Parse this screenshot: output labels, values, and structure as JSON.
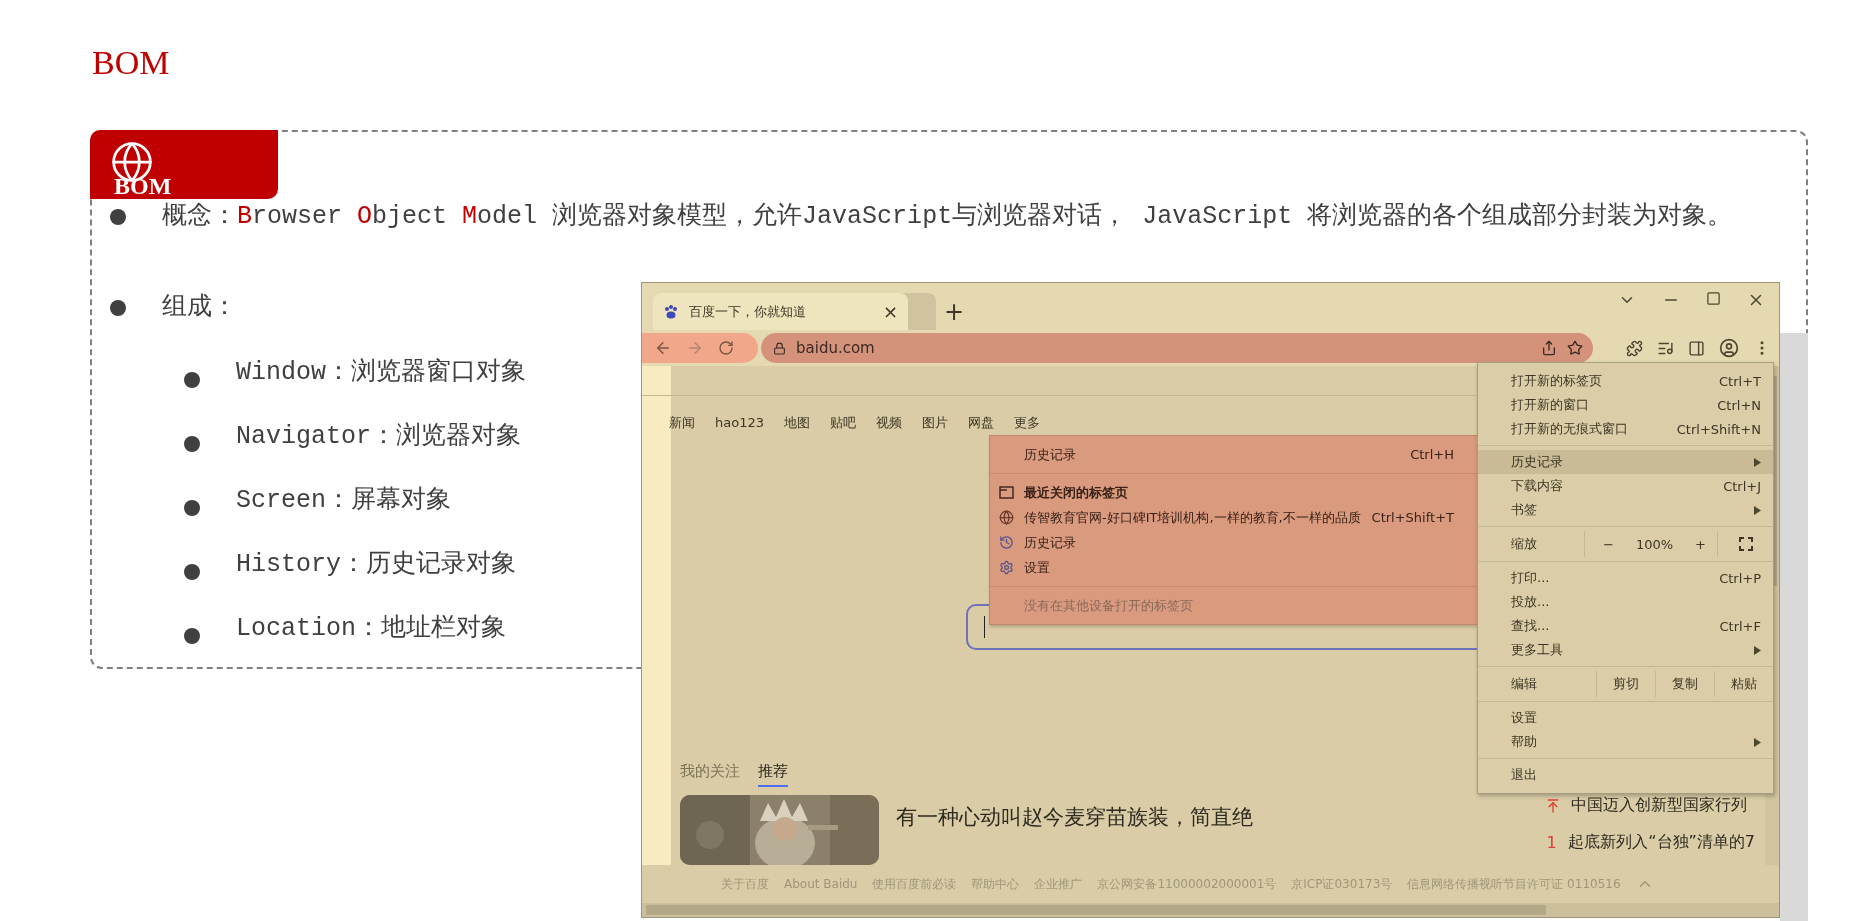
{
  "slide": {
    "title": "BOM",
    "badge_label": "BOM"
  },
  "bullets": [
    {
      "segments": [
        {
          "text": "概念：",
          "accent": false
        },
        {
          "text": "B",
          "accent": true
        },
        {
          "text": "rowser ",
          "accent": false
        },
        {
          "text": "O",
          "accent": true
        },
        {
          "text": "bject ",
          "accent": false
        },
        {
          "text": "M",
          "accent": true
        },
        {
          "text": "odel  浏览器对象模型，允许JavaScript与浏览器对话， JavaScript 将浏览器的各个组成部分封装为对象。",
          "accent": false
        }
      ]
    },
    {
      "segments": [
        {
          "text": "组成：",
          "accent": false
        }
      ],
      "children": [
        "Window：浏览器窗口对象",
        "Navigator：浏览器对象",
        "Screen：屏幕对象",
        "History：历史记录对象",
        "Location：地址栏对象"
      ]
    }
  ],
  "browser": {
    "tab": {
      "title": "百度一下，你就知道",
      "close": "×"
    },
    "new_tab": "+",
    "address": "baidu.com",
    "nav_links": [
      "新闻",
      "hao123",
      "地图",
      "贴吧",
      "视频",
      "图片",
      "网盘",
      "更多"
    ],
    "feed_tabs": [
      {
        "label": "我的关注",
        "selected": false
      },
      {
        "label": "推荐",
        "selected": true
      }
    ],
    "news": {
      "kind": "picture",
      "headline": "有一种心动叫赵今麦穿苗族装，简直绝"
    },
    "hot_list": [
      {
        "kind": "top",
        "text": "中国迈入创新型国家行列"
      },
      {
        "kind": "rank",
        "rank": "1",
        "text": "起底新列入“台独”清单的7"
      }
    ],
    "footer_links": [
      "关于百度",
      "About Baidu",
      "使用百度前必读",
      "帮助中心",
      "企业推广",
      "京公网安备11000002000001号",
      "京ICP证030173号",
      "信息网络传播视听节目许可证 0110516"
    ],
    "history_menu": [
      {
        "kind": "header",
        "label": "历史记录",
        "shortcut": "Ctrl+H"
      },
      {
        "kind": "divider"
      },
      {
        "kind": "heading",
        "label": "最近关闭的标签页"
      },
      {
        "kind": "page",
        "label": "传智教育官网-好口碑IT培训机构,一样的教育,不一样的品质",
        "shortcut": "Ctrl+Shift+T"
      },
      {
        "kind": "history",
        "label": "历史记录"
      },
      {
        "kind": "settings",
        "label": "设置"
      },
      {
        "kind": "divider"
      },
      {
        "kind": "note",
        "label": "没有在其他设备打开的标签页"
      }
    ],
    "main_menu": [
      {
        "kind": "item",
        "label": "打开新的标签页",
        "shortcut": "Ctrl+T",
        "submenu": false,
        "selected": false
      },
      {
        "kind": "item",
        "label": "打开新的窗口",
        "shortcut": "Ctrl+N",
        "submenu": false,
        "selected": false
      },
      {
        "kind": "item",
        "label": "打开新的无痕式窗口",
        "shortcut": "Ctrl+Shift+N",
        "submenu": false,
        "selected": false
      },
      {
        "kind": "divider"
      },
      {
        "kind": "item",
        "label": "历史记录",
        "submenu": true,
        "selected": true
      },
      {
        "kind": "item",
        "label": "下载内容",
        "shortcut": "Ctrl+J",
        "submenu": false,
        "selected": false
      },
      {
        "kind": "item",
        "label": "书签",
        "submenu": true,
        "selected": false
      },
      {
        "kind": "divider"
      },
      {
        "kind": "zoom",
        "label": "缩放",
        "minus": "−",
        "value": "100%",
        "plus": "+"
      },
      {
        "kind": "divider"
      },
      {
        "kind": "item",
        "label": "打印...",
        "shortcut": "Ctrl+P",
        "submenu": false,
        "selected": false
      },
      {
        "kind": "item",
        "label": "投放...",
        "submenu": false,
        "selected": false
      },
      {
        "kind": "item",
        "label": "查找...",
        "shortcut": "Ctrl+F",
        "submenu": false,
        "selected": false
      },
      {
        "kind": "item",
        "label": "更多工具",
        "submenu": true,
        "selected": false
      },
      {
        "kind": "divider"
      },
      {
        "kind": "edit",
        "label": "编辑",
        "actions": [
          "剪切",
          "复制",
          "粘贴"
        ]
      },
      {
        "kind": "divider"
      },
      {
        "kind": "item",
        "label": "设置",
        "submenu": false,
        "selected": false
      },
      {
        "kind": "item",
        "label": "帮助",
        "submenu": true,
        "selected": false
      },
      {
        "kind": "divider"
      },
      {
        "kind": "item",
        "label": "退出",
        "submenu": false,
        "selected": false
      }
    ]
  }
}
